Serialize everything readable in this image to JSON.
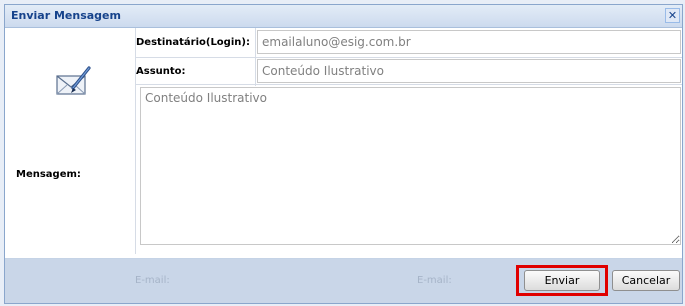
{
  "window": {
    "title": "Enviar Mensagem",
    "close_glyph": "✕"
  },
  "form": {
    "recipient_label": "Destinatário(Login):",
    "recipient_value": "emailaluno@esig.com.br",
    "subject_label": "Assunto:",
    "subject_value": "Conteúdo Ilustrativo",
    "message_label": "Mensagem:",
    "message_value": "Conteúdo Ilustrativo"
  },
  "footer": {
    "ghost_left": "E-mail:",
    "ghost_right": "E-mail:",
    "send_label": "Enviar",
    "cancel_label": "Cancelar"
  },
  "colors": {
    "title_text": "#15428b",
    "highlight": "#e00000",
    "footer_bg": "#c9d6e8"
  },
  "icons": {
    "compose": "envelope-pen-icon",
    "close": "close-icon"
  }
}
